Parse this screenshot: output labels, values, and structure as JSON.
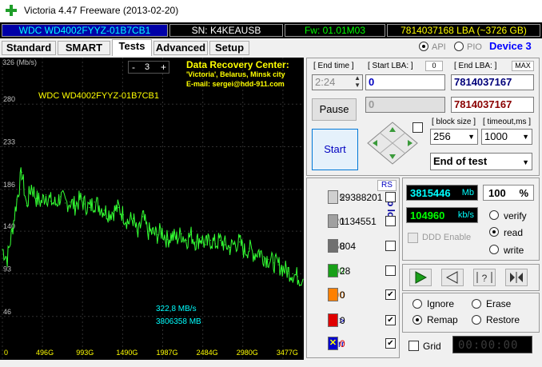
{
  "window": {
    "title": "Victoria 4.47  Freeware (2013-02-20)",
    "controls": {
      "minimize": "—",
      "maximize": "☐",
      "close": "✕"
    }
  },
  "infobar": {
    "model": "WDC WD4002FYYZ-01B7CB1",
    "serial": "SN: K4KEAUSB",
    "firmware": "Fw: 01.01M03",
    "capacity": "7814037168 LBA (~3726 GB)"
  },
  "tabs": [
    "Standard",
    "SMART",
    "Tests",
    "Advanced",
    "Setup"
  ],
  "interface": {
    "api": "API",
    "pio": "PIO",
    "device": "Device 3"
  },
  "chart": {
    "ylabel": "326 (Mb/s)",
    "yticks": [
      "280",
      "233",
      "186",
      "140",
      "93",
      "46"
    ],
    "xticks": [
      "0",
      "496G",
      "993G",
      "1490G",
      "1987G",
      "2484G",
      "2980G",
      "3477G"
    ],
    "disk_label": "WDC WD4002FYYZ-01B7CB1",
    "speed_now": "322,8 MB/s",
    "lba_now": "3806358 MB",
    "zoom": {
      "minus": "-",
      "value": "3",
      "plus": "+"
    },
    "ad_title": "Data Recovery Center:",
    "ad_line1": "'Victoria', Belarus, Minsk city",
    "ad_line2": "E-mail: sergei@hdd-911.com"
  },
  "chart_data": {
    "type": "line",
    "ylim": [
      0,
      326
    ],
    "xlim": [
      0,
      3726
    ],
    "x": [
      0,
      60,
      120,
      180,
      240,
      300,
      360,
      420,
      480,
      540,
      600,
      660,
      720,
      780,
      840,
      900,
      960,
      1020,
      1080,
      1140,
      1200,
      1260,
      1320,
      1380,
      1440,
      1500,
      1560,
      1620,
      1680,
      1740,
      1800,
      1860,
      1920,
      1980,
      2040,
      2100,
      2160,
      2220,
      2280,
      2340,
      2400,
      2460,
      2520,
      2580,
      2640,
      2700,
      2760,
      2820,
      2880,
      2940,
      3000,
      3060,
      3120,
      3180,
      3240,
      3300,
      3360,
      3420,
      3480,
      3540,
      3600,
      3660,
      3726
    ],
    "values": [
      120,
      110,
      140,
      175,
      205,
      168,
      190,
      176,
      172,
      180,
      173,
      170,
      178,
      171,
      172,
      168,
      175,
      170,
      166,
      172,
      168,
      163,
      160,
      162,
      166,
      158,
      150,
      154,
      134,
      156,
      140,
      138,
      136,
      140,
      131,
      135,
      132,
      137,
      130,
      136,
      128,
      133,
      125,
      130,
      126,
      130,
      125,
      122,
      126,
      128,
      118,
      121,
      115,
      118,
      112,
      109,
      105,
      103,
      99,
      96,
      93,
      90,
      87
    ]
  },
  "lba": {
    "end_time_label": "[ End time ]",
    "end_time": "2:24",
    "start_lba_label": "[ Start LBA: ]",
    "start_lba_badge": "0",
    "start_lba": "0",
    "end_lba_label": "[ End LBA: ]",
    "end_lba_badge": "MAX",
    "end_lba": "7814037167",
    "start_lba2": "0",
    "end_lba2": "7814037167",
    "pause": "Pause",
    "start": "Start",
    "block_size_label": "[ block size ]",
    "block_size": "256",
    "timeout_label": "[ timeout,ms ]",
    "timeout": "1000",
    "mode": "End of test"
  },
  "counters": {
    "rs": "RS",
    "to_log": "to log:",
    "rows": [
      {
        "label": "5",
        "value": "29388201",
        "color": "#d0d0d0",
        "label_color": "#555555",
        "checked": false
      },
      {
        "label": "20",
        "value": "1134551",
        "color": "#a0a0a0",
        "label_color": "#555555",
        "checked": false
      },
      {
        "label": "50",
        "value": "804",
        "color": "#707070",
        "label_color": "#555555",
        "checked": false
      },
      {
        "label": "200",
        "value": "28",
        "color": "#18a018",
        "label_color": "#18a018",
        "checked": false
      },
      {
        "label": "600",
        "value": "0",
        "color": "#ff8000",
        "label_color": "#ff8000",
        "checked": true
      },
      {
        "label": ">",
        "value": "0",
        "color": "#e00000",
        "label_color": "#0000c0",
        "checked": true
      },
      {
        "label": "Err",
        "value": "0",
        "color": "#0000d0",
        "label_color": "#0000c0",
        "checked": true
      }
    ]
  },
  "status": {
    "mb": "3815446",
    "mb_unit": "Mb",
    "percent": "100",
    "percent_unit": "%",
    "speed": "104960",
    "speed_unit": "kb/s",
    "ddd": "DDD Enable",
    "verify": "verify",
    "read": "read",
    "write": "write"
  },
  "actions": {
    "ignore": "Ignore",
    "erase": "Erase",
    "remap": "Remap",
    "restore": "Restore",
    "grid": "Grid",
    "timer": "00:00:00"
  },
  "colors": {
    "chart_line": "#33ff33",
    "lcd_bg": "#000000",
    "lcd_cyan": "#00ffff"
  }
}
